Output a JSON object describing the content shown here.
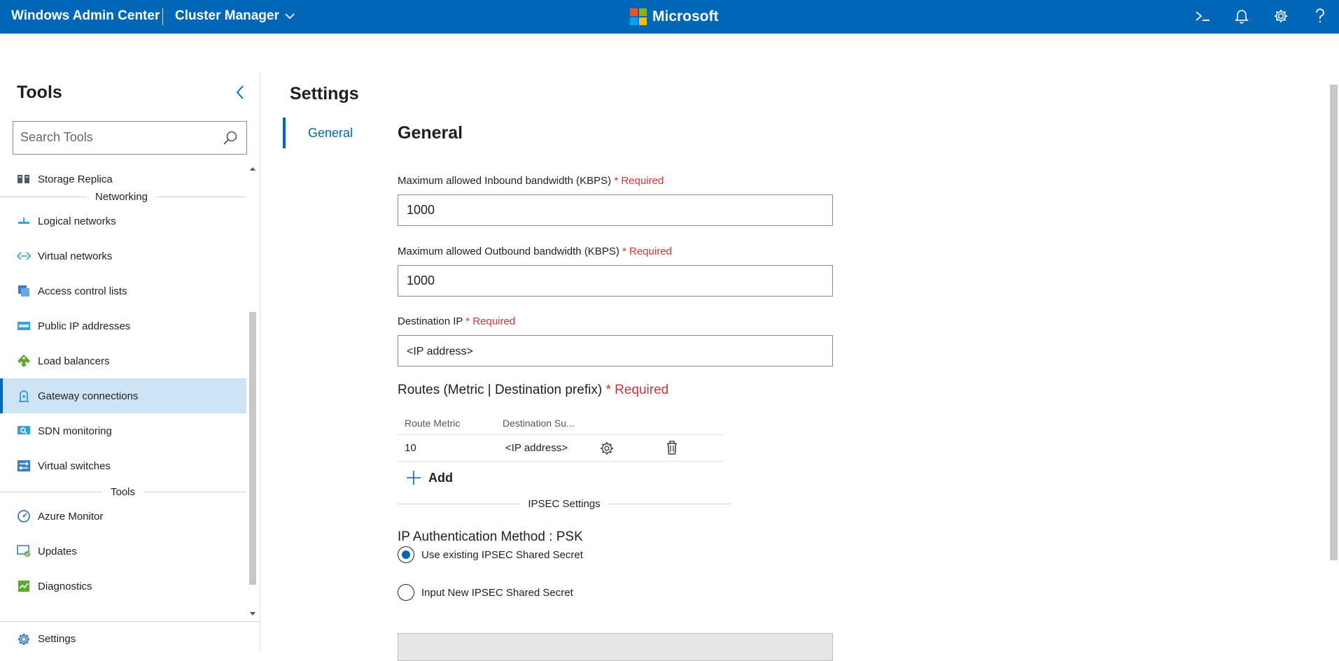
{
  "header": {
    "brand": "Windows Admin Center",
    "context": "Cluster Manager",
    "vendor": "Microsoft",
    "icons": [
      "terminal-icon",
      "bell-icon",
      "gear-icon",
      "help-icon"
    ]
  },
  "sidebar": {
    "title": "Tools",
    "search_placeholder": "Search Tools",
    "items": [
      {
        "label": "Storage Replica",
        "icon": "storage-replica-icon"
      },
      {
        "section": "Networking"
      },
      {
        "label": "Logical networks",
        "icon": "logical-networks-icon"
      },
      {
        "label": "Virtual networks",
        "icon": "virtual-networks-icon"
      },
      {
        "label": "Access control lists",
        "icon": "acl-icon"
      },
      {
        "label": "Public IP addresses",
        "icon": "public-ip-icon"
      },
      {
        "label": "Load balancers",
        "icon": "load-balancer-icon"
      },
      {
        "label": "Gateway connections",
        "icon": "gateway-icon",
        "active": true
      },
      {
        "label": "SDN monitoring",
        "icon": "sdn-monitoring-icon"
      },
      {
        "label": "Virtual switches",
        "icon": "virtual-switch-icon"
      },
      {
        "section": "Tools"
      },
      {
        "label": "Azure Monitor",
        "icon": "azure-monitor-icon"
      },
      {
        "label": "Updates",
        "icon": "updates-icon"
      },
      {
        "label": "Diagnostics",
        "icon": "diagnostics-icon"
      }
    ],
    "settings_label": "Settings"
  },
  "main": {
    "title": "Settings",
    "subnav_general": "General",
    "section_title": "General",
    "fields": {
      "inbound_label": "Maximum allowed Inbound bandwidth (KBPS)",
      "inbound_value": "1000",
      "outbound_label": "Maximum allowed Outbound bandwidth (KBPS)",
      "outbound_value": "1000",
      "dest_ip_label": "Destination IP",
      "dest_ip_placeholder": "<IP address>",
      "required": "* Required"
    },
    "routes": {
      "title": "Routes (Metric | Destination prefix)",
      "col_metric": "Route Metric",
      "col_dest": "Destination Su...",
      "rows": [
        {
          "metric": "10",
          "dest": "<IP address>"
        }
      ],
      "add_label": "Add"
    },
    "ipsec": {
      "separator": "IPSEC Settings",
      "auth_title": "IP Authentication Method : PSK",
      "option_existing": "Use existing IPSEC Shared Secret",
      "option_new": "Input New IPSEC Shared Secret",
      "selected": "existing"
    }
  },
  "colors": {
    "accent": "#0067b8",
    "required": "#d13438",
    "active_bg": "#cce4f6"
  }
}
